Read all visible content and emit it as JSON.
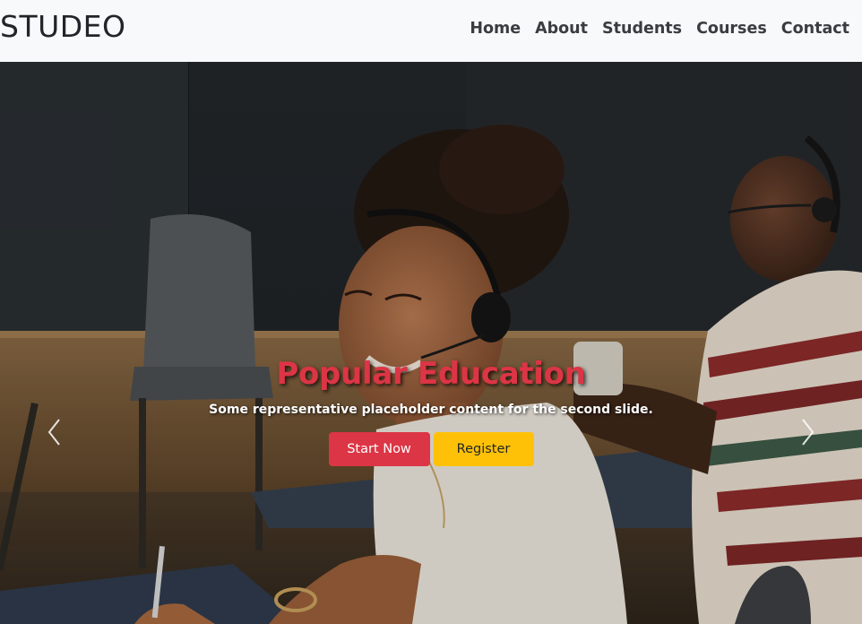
{
  "navbar": {
    "brand": "STUDEO",
    "links": [
      "Home",
      "About",
      "Students",
      "Courses",
      "Contact"
    ]
  },
  "hero": {
    "title": "Popular Education",
    "text": "Some representative placeholder content for the second slide.",
    "primary_button": "Start Now",
    "secondary_button": "Register",
    "prev_icon": "chevron-left-icon",
    "next_icon": "chevron-right-icon"
  },
  "colors": {
    "navbar_bg": "#f8f9fa",
    "title": "#dc3545",
    "primary_button": "#dc3545",
    "secondary_button": "#ffc107"
  }
}
